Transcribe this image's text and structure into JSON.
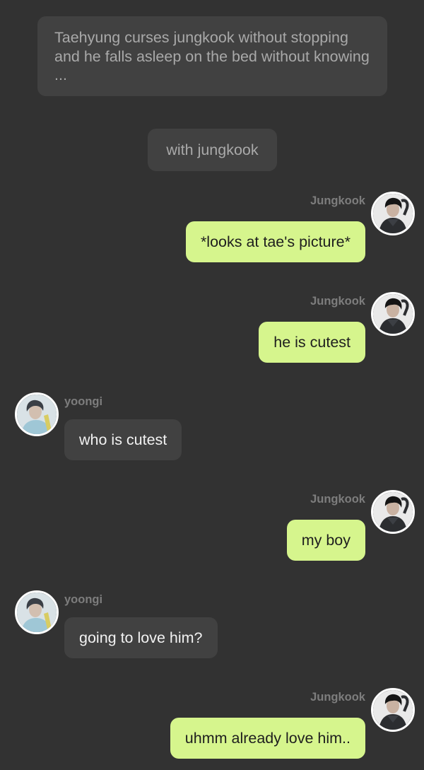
{
  "narration": "Taehyung curses jungkook without stopping and he falls asleep on the bed without knowing ...",
  "scene": "with jungkook",
  "messages": [
    {
      "sender": "Jungkook",
      "text": "*looks at tae's picture*",
      "side": "right"
    },
    {
      "sender": "Jungkook",
      "text": "he is cutest",
      "side": "right"
    },
    {
      "sender": "yoongi",
      "text": "who is cutest",
      "side": "left"
    },
    {
      "sender": "Jungkook",
      "text": "my boy",
      "side": "right"
    },
    {
      "sender": "yoongi",
      "text": "going to love him?",
      "side": "left"
    },
    {
      "sender": "Jungkook",
      "text": "uhmm already love him..",
      "side": "right"
    }
  ],
  "colors": {
    "background": "#323232",
    "narration_bubble": "#414141",
    "outgoing_bubble": "#d6f58d",
    "incoming_bubble": "#414141",
    "sender_name": "#7d7d7d"
  },
  "avatars": {
    "jungkook": "jungkook-avatar-photo",
    "yoongi": "yoongi-avatar-photo"
  }
}
